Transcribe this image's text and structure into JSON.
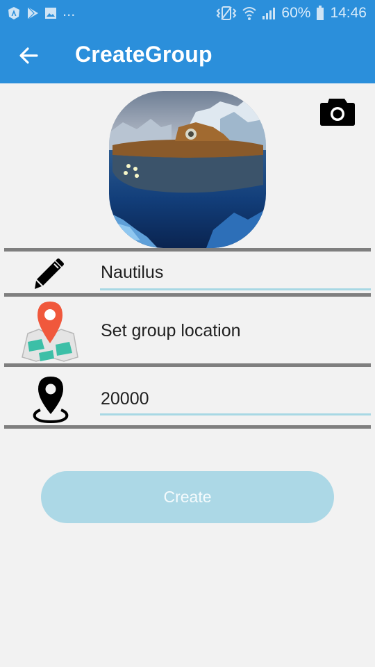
{
  "status_bar": {
    "battery_text": "60%",
    "time": "14:46",
    "overflow": "...",
    "icons": [
      "app-notification-icon",
      "play-store-icon",
      "image-icon",
      "vibrate-icon",
      "wifi-icon",
      "signal-icon",
      "battery-icon"
    ]
  },
  "app_bar": {
    "title": "CreateGroup",
    "back_icon": "arrow-left-icon",
    "color": "#2b8fdb"
  },
  "avatar": {
    "description_icon": "group-photo",
    "camera_icon": "camera-icon"
  },
  "fields": {
    "name": {
      "icon": "pencil-icon",
      "value": "Nautilus"
    },
    "location": {
      "icon": "map-location-icon",
      "label": "Set group location"
    },
    "radius": {
      "icon": "map-pin-icon",
      "value": "20000"
    }
  },
  "create_button": {
    "label": "Create",
    "color": "#acd8e6"
  }
}
